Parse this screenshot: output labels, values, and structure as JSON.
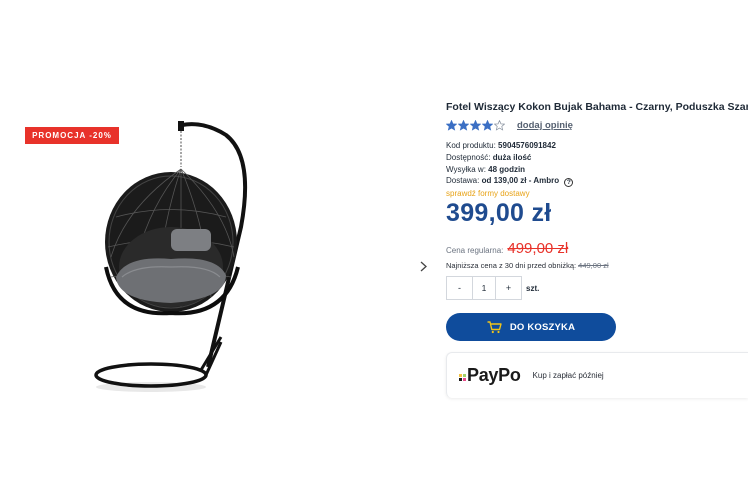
{
  "gallery": {
    "promo_badge": "PROMOCJA -20%"
  },
  "product": {
    "title": "Fotel Wiszący Kokon Bujak Bahama - Czarny, Poduszka Szara",
    "rating": 4,
    "rating_max": 5,
    "add_review": "dodaj opinię",
    "specs": {
      "code_label": "Kod produktu:",
      "code_value": "5904576091842",
      "availability_label": "Dostępność:",
      "availability_value": "duża ilość",
      "shipping_label": "Wysyłka w:",
      "shipping_value": "48 godzin",
      "delivery_label": "Dostawa:",
      "delivery_value": "od 139,00 zł - Ambro",
      "delivery_link": "sprawdź formy dostawy"
    },
    "price": "399,00 zł",
    "regular_label": "Cena regularna:",
    "regular_price": "499,00 zł",
    "lowest_label": "Najniższa cena z 30 dni przed obniżką:",
    "lowest_price": "449,00 zł",
    "quantity": {
      "minus": "-",
      "value": "1",
      "plus": "+",
      "unit": "szt."
    },
    "cart_button": "DO KOSZYKA",
    "paypo": {
      "logo": "PayPo",
      "slogan": "Kup i zapłać później"
    }
  },
  "colors": {
    "accent": "#0f4c9c",
    "price": "#1f4b8f",
    "promo": "#e8322a",
    "star": "#3b6fc4",
    "link_orange": "#e8a317"
  }
}
